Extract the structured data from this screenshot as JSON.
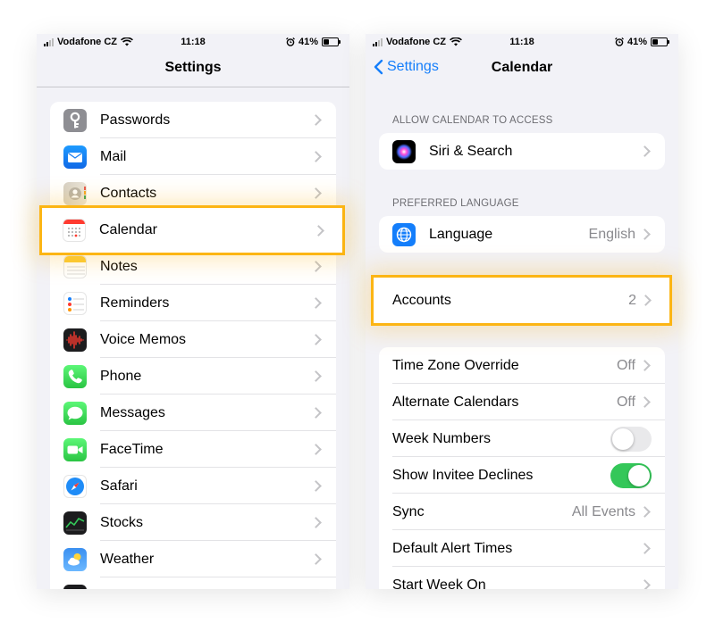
{
  "status_bar": {
    "carrier": "Vodafone CZ",
    "time": "11:18",
    "battery": "41%"
  },
  "left": {
    "title": "Settings",
    "items": [
      {
        "label": "Passwords",
        "icon": "key-icon"
      },
      {
        "label": "Mail",
        "icon": "mail-icon"
      },
      {
        "label": "Contacts",
        "icon": "contacts-icon"
      },
      {
        "label": "Calendar",
        "icon": "calendar-icon"
      },
      {
        "label": "Notes",
        "icon": "notes-icon"
      },
      {
        "label": "Reminders",
        "icon": "reminders-icon"
      },
      {
        "label": "Voice Memos",
        "icon": "voice-memos-icon"
      },
      {
        "label": "Phone",
        "icon": "phone-icon"
      },
      {
        "label": "Messages",
        "icon": "messages-icon"
      },
      {
        "label": "FaceTime",
        "icon": "facetime-icon"
      },
      {
        "label": "Safari",
        "icon": "safari-icon"
      },
      {
        "label": "Stocks",
        "icon": "stocks-icon"
      },
      {
        "label": "Weather",
        "icon": "weather-icon"
      }
    ]
  },
  "right": {
    "back": "Settings",
    "title": "Calendar",
    "section_access": "ALLOW CALENDAR TO ACCESS",
    "siri": {
      "label": "Siri & Search",
      "icon": "siri-icon"
    },
    "section_language": "PREFERRED LANGUAGE",
    "language": {
      "label": "Language",
      "value": "English",
      "icon": "globe-icon"
    },
    "accounts": {
      "label": "Accounts",
      "value": "2"
    },
    "settings": [
      {
        "label": "Time Zone Override",
        "value": "Off"
      },
      {
        "label": "Alternate Calendars",
        "value": "Off"
      },
      {
        "label": "Week Numbers",
        "toggle": false
      },
      {
        "label": "Show Invitee Declines",
        "toggle": true
      },
      {
        "label": "Sync",
        "value": "All Events"
      },
      {
        "label": "Default Alert Times"
      },
      {
        "label": "Start Week On"
      }
    ]
  },
  "colors": {
    "highlight": "#fcb514",
    "ios_blue": "#147efb",
    "toggle_on": "#34c759"
  }
}
